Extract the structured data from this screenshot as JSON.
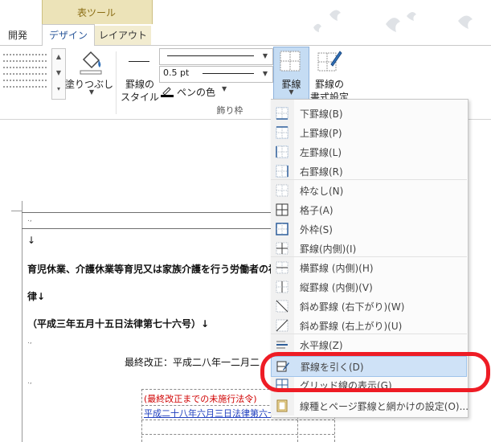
{
  "tabs": {
    "context_group": "表ツール",
    "items": [
      "開発",
      "デザイン",
      "レイアウト"
    ]
  },
  "ribbon": {
    "shading_label": "塗りつぶし",
    "border_style_label_1": "罫線の",
    "border_style_label_2": "スタイル",
    "line_weight_value": "0.5 pt",
    "pen_color_label": "ペンの色",
    "group_label": "飾り枠",
    "borders_label": "罫線",
    "painter_label_1": "罫線の",
    "painter_label_2": "書式設定"
  },
  "menu": {
    "items": [
      {
        "label": "下罫線(B)",
        "icon": "bottom-border-icon"
      },
      {
        "label": "上罫線(P)",
        "icon": "top-border-icon"
      },
      {
        "label": "左罫線(L)",
        "icon": "left-border-icon"
      },
      {
        "label": "右罫線(R)",
        "icon": "right-border-icon"
      },
      {
        "label": "枠なし(N)",
        "icon": "no-border-icon"
      },
      {
        "label": "格子(A)",
        "icon": "all-borders-icon"
      },
      {
        "label": "外枠(S)",
        "icon": "outside-borders-icon"
      },
      {
        "label": "罫線(内側)(I)",
        "icon": "inside-borders-icon"
      },
      {
        "label": "横罫線 (内側)(H)",
        "icon": "inside-horizontal-border-icon"
      },
      {
        "label": "縦罫線 (内側)(V)",
        "icon": "inside-vertical-border-icon"
      },
      {
        "label": "斜め罫線 (右下がり)(W)",
        "icon": "diagonal-down-border-icon"
      },
      {
        "label": "斜め罫線 (右上がり)(U)",
        "icon": "diagonal-up-border-icon"
      },
      {
        "label": "水平線(Z)",
        "icon": "horizontal-line-icon"
      },
      {
        "label": "罫線を引く(D)",
        "icon": "draw-table-icon"
      },
      {
        "label": "グリッド線の表示(G)",
        "icon": "view-gridlines-icon"
      },
      {
        "label": "線種とページ罫線と網かけの設定(O)...",
        "icon": "borders-and-shading-icon"
      }
    ]
  },
  "document": {
    "line1": "育児休業、介護休業等育児又は家族介護を行う労働者の福",
    "line2": "律↓",
    "line3": "（平成三年五月十五日法律第七十六号）↓",
    "line4": "最終改正：平成二八年一二月二",
    "table_red": "(最終改正までの未施行法令)",
    "table_blue": "平成二十八年六月三日法律第六十",
    "para_mark": "↓",
    "cell_mark": ".,"
  },
  "colors": {
    "accent": "#2b579a",
    "context_tab": "#ece3b8",
    "highlight": "#cfe2f7",
    "callout": "#ee1c25",
    "red_text": "#d00000",
    "blue_text": "#1f3fbf"
  }
}
